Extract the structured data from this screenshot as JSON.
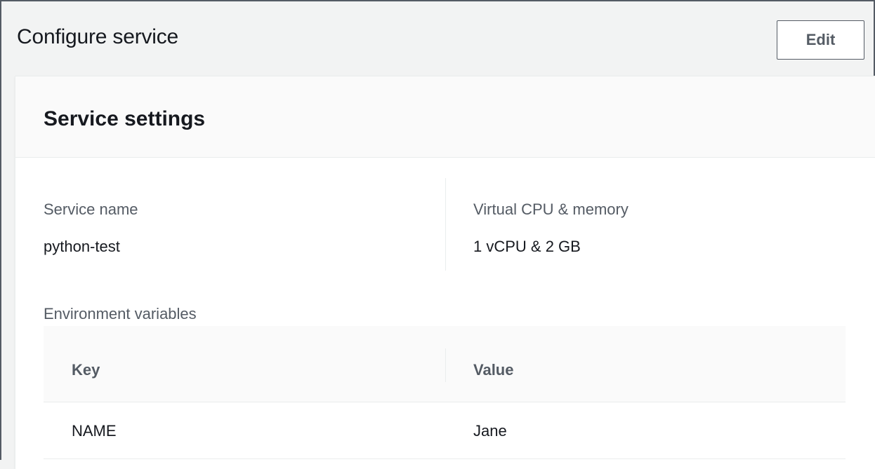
{
  "header": {
    "title": "Configure service",
    "edit_label": "Edit"
  },
  "card": {
    "title": "Service settings",
    "service_name": {
      "label": "Service name",
      "value": "python-test"
    },
    "cpu_memory": {
      "label": "Virtual CPU & memory",
      "value": "1 vCPU & 2 GB"
    },
    "env": {
      "label": "Environment variables",
      "columns": [
        "Key",
        "Value"
      ],
      "rows": [
        {
          "key": "NAME",
          "value": "Jane"
        }
      ]
    }
  }
}
